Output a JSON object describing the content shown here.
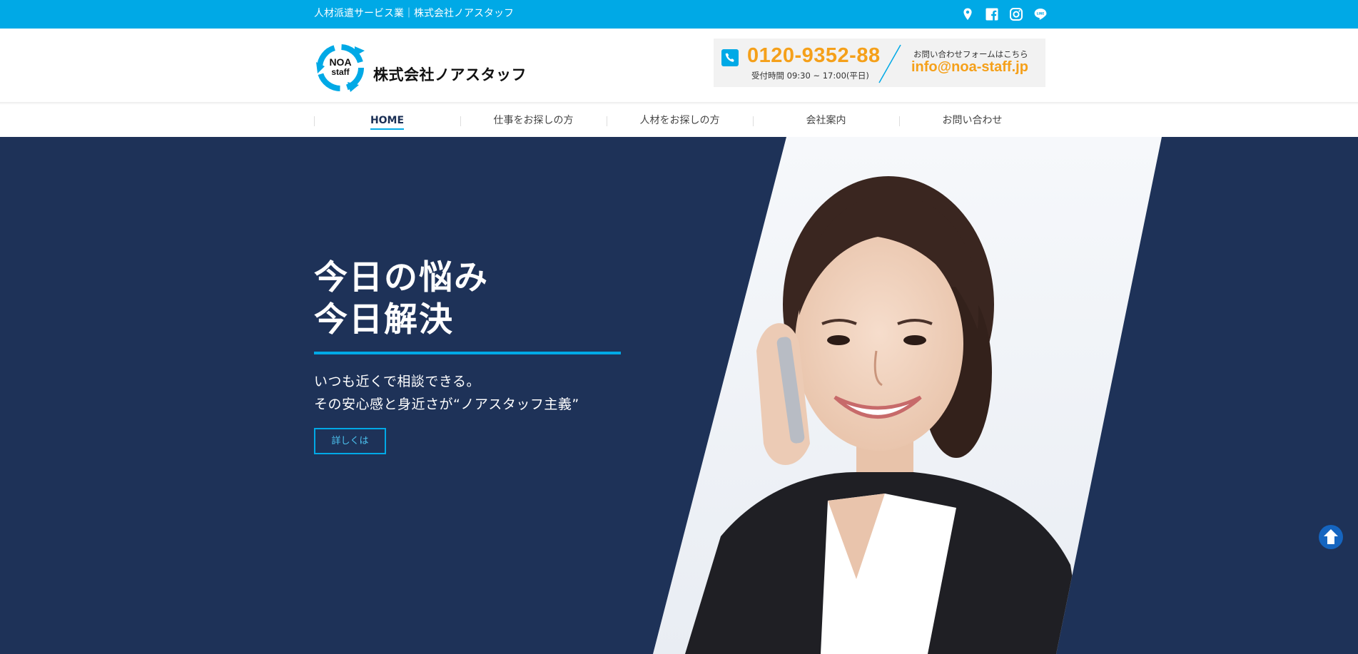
{
  "topbar": {
    "tagline": "人材派遣サービス業｜株式会社ノアスタッフ",
    "icons": [
      "map-pin-icon",
      "facebook-icon",
      "instagram-icon",
      "line-icon"
    ]
  },
  "header": {
    "logo_mark": {
      "line1": "NOA",
      "line2": "staff"
    },
    "company_name": "株式会社ノアスタッフ",
    "phone": "0120-9352-88",
    "hours": "受付時間 09:30 ~ 17:00(平日)",
    "form_note": "お問い合わせフォームはこちら",
    "email": "info@noa-staff.jp"
  },
  "nav": {
    "items": [
      {
        "label": "HOME",
        "active": true
      },
      {
        "label": "仕事をお探しの方",
        "active": false
      },
      {
        "label": "人材をお探しの方",
        "active": false
      },
      {
        "label": "会社案内",
        "active": false
      },
      {
        "label": "お問い合わせ",
        "active": false
      }
    ]
  },
  "hero": {
    "title_line1": "今日の悩み",
    "title_line2": "今日解決",
    "sub_line1": "いつも近くで相談できる。",
    "sub_line2": "その安心感と身近さが“ノアスタッフ主義”",
    "button_label": "詳しくは"
  },
  "colors": {
    "accent": "#00a9e6",
    "navy": "#1e3258",
    "orange": "#f5a01a",
    "back_to_top": "#1565c0"
  }
}
